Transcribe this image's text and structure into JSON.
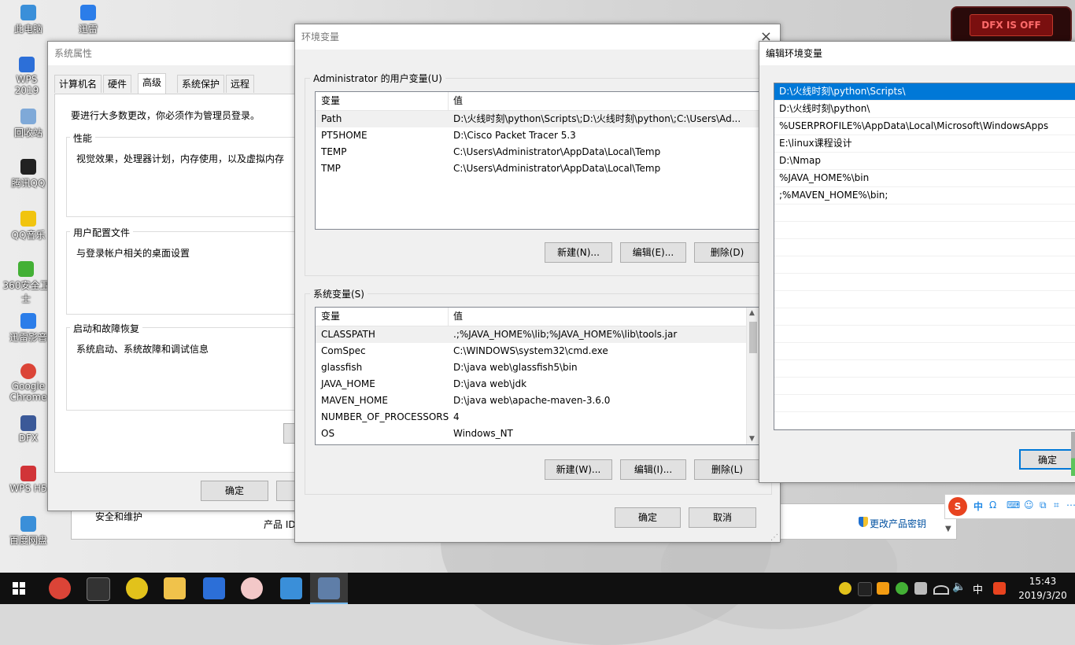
{
  "desktop_icons": [
    {
      "label": "此电脑",
      "color": "#3a8fd9"
    },
    {
      "label": "迅雷",
      "color": "#2b7de9"
    },
    {
      "label": "WPS 2019",
      "color": "#2c6fd8"
    },
    {
      "label": "回收站",
      "color": "#7fa9d8"
    },
    {
      "label": "腾讯QQ",
      "color": "#222222"
    },
    {
      "label": "QQ音乐",
      "color": "#f1c40f"
    },
    {
      "label": "360安全卫士",
      "color": "#43b035"
    },
    {
      "label": "迅雷影音",
      "color": "#2b7de9"
    },
    {
      "label": "Google Chrome",
      "color": "#db4437"
    },
    {
      "label": "DFX",
      "color": "#3b5998"
    },
    {
      "label": "WPS H5",
      "color": "#d13438"
    },
    {
      "label": "百度网盘",
      "color": "#3a8fd9"
    }
  ],
  "dfx_widget": {
    "text": "DFX IS OFF"
  },
  "sysprops": {
    "title": "系统属性",
    "tabs": [
      "计算机名",
      "硬件",
      "高级",
      "系统保护",
      "远程"
    ],
    "selected_tab": "高级",
    "admin_note": "要进行大多数更改，你必须作为管理员登录。",
    "perf_title": "性能",
    "perf_desc": "视觉效果，处理器计划，内存使用，以及虚拟内存",
    "profile_title": "用户配置文件",
    "profile_desc": "与登录帐户相关的桌面设置",
    "startup_title": "启动和故障恢复",
    "startup_desc": "系统启动、系统故障和调试信息",
    "ok": "确定"
  },
  "bg_panel": {
    "security": "安全和维护",
    "product_id": "产品 ID",
    "change_key": "更改产品密钥"
  },
  "envvars": {
    "title": "环境变量",
    "close": "×",
    "user_group": "Administrator 的用户变量(U)",
    "col_var": "变量",
    "col_val": "值",
    "user_vars": [
      {
        "name": "Path",
        "value": "D:\\火线时刻\\python\\Scripts\\;D:\\火线时刻\\python\\;C:\\Users\\Ad..."
      },
      {
        "name": "PT5HOME",
        "value": "D:\\Cisco Packet Tracer 5.3"
      },
      {
        "name": "TEMP",
        "value": "C:\\Users\\Administrator\\AppData\\Local\\Temp"
      },
      {
        "name": "TMP",
        "value": "C:\\Users\\Administrator\\AppData\\Local\\Temp"
      }
    ],
    "user_new": "新建(N)...",
    "user_edit": "编辑(E)...",
    "user_delete": "删除(D)",
    "sys_group": "系统变量(S)",
    "sys_vars": [
      {
        "name": "CLASSPATH",
        "value": ".;%JAVA_HOME%\\lib;%JAVA_HOME%\\lib\\tools.jar"
      },
      {
        "name": "ComSpec",
        "value": "C:\\WINDOWS\\system32\\cmd.exe"
      },
      {
        "name": "glassfish",
        "value": "D:\\java web\\glassfish5\\bin"
      },
      {
        "name": "JAVA_HOME",
        "value": "D:\\java web\\jdk"
      },
      {
        "name": "MAVEN_HOME",
        "value": "D:\\java web\\apache-maven-3.6.0"
      },
      {
        "name": "NUMBER_OF_PROCESSORS",
        "value": "4"
      },
      {
        "name": "OS",
        "value": "Windows_NT"
      }
    ],
    "sys_new": "新建(W)...",
    "sys_edit": "编辑(I)...",
    "sys_delete": "删除(L)",
    "ok": "确定",
    "cancel": "取消"
  },
  "editenv": {
    "title": "编辑环境变量",
    "entries": [
      "D:\\火线时刻\\python\\Scripts\\",
      "D:\\火线时刻\\python\\",
      "%USERPROFILE%\\AppData\\Local\\Microsoft\\WindowsApps",
      "E:\\linux课程设计",
      "D:\\Nmap",
      "%JAVA_HOME%\\bin",
      ";%MAVEN_HOME%\\bin;"
    ],
    "selected_index": 0,
    "ok": "确定"
  },
  "ime_bar": {
    "items": [
      "S",
      "中",
      "Ω",
      "⌨",
      "☺",
      "⧉",
      "⌗",
      "⋯"
    ]
  },
  "taskbar": {
    "apps": [
      {
        "name": "chrome-app-icon",
        "color": "#db4437"
      },
      {
        "name": "cmd-app-icon",
        "color": "#333333"
      },
      {
        "name": "360-app-icon",
        "color": "#e2c21b"
      },
      {
        "name": "explorer-app-icon",
        "color": "#f0c24b"
      },
      {
        "name": "vs-app-icon",
        "color": "#2c6fd8"
      },
      {
        "name": "app-icon-6",
        "color": "#f3c8c8"
      },
      {
        "name": "control-panel-app-icon",
        "color": "#3a8fd9"
      },
      {
        "name": "system-app-icon",
        "color": "#5f7ea8"
      }
    ],
    "ime": "中",
    "time": "15:43",
    "date": "2019/3/20"
  }
}
